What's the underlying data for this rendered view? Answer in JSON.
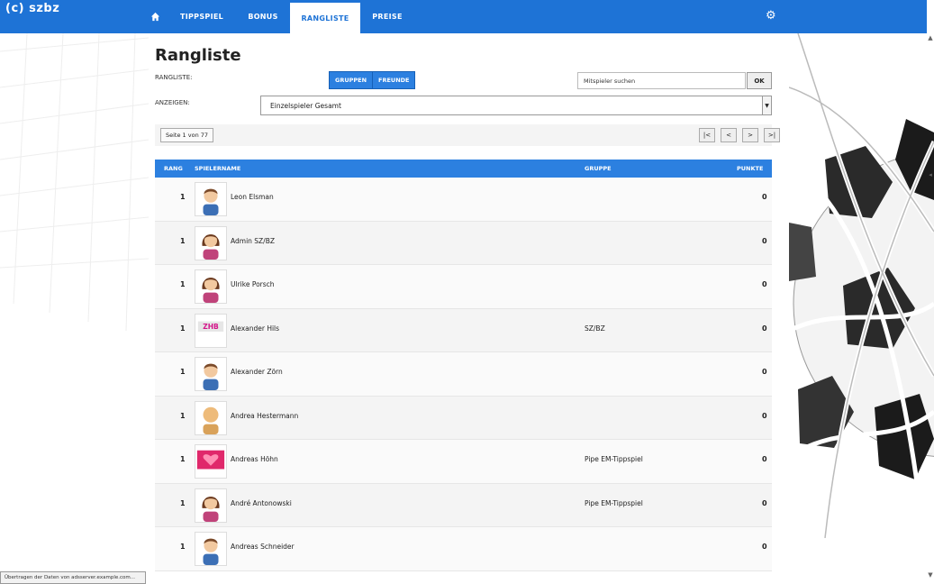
{
  "brand": "(c) szbz",
  "nav": {
    "home_icon": "home-icon",
    "items": [
      {
        "label": "TIPPSPIEL"
      },
      {
        "label": "BONUS"
      },
      {
        "label": "RANGLISTE"
      },
      {
        "label": "PREISE"
      }
    ],
    "active": "RANGLISTE",
    "settings_icon": "gear-icon"
  },
  "page": {
    "title": "Rangliste",
    "rangliste_label": "RANGLISTE:",
    "toggle": [
      "GRUPPEN",
      "FREUNDE"
    ],
    "search_value": "Mitspieler suchen",
    "ok_label": "OK",
    "anzeigen_label": "ANZEIGEN:",
    "select_value": "Einzelspieler Gesamt",
    "page_info": "Seite 1 von 77",
    "pager": [
      "|<",
      "<",
      ">",
      ">|"
    ]
  },
  "table": {
    "headers": {
      "rank": "RANG",
      "player": "SPIELERNAME",
      "group": "GRUPPE",
      "points": "PUNKTE"
    },
    "rows": [
      {
        "rank": "1",
        "avatar": "boy-avatar-icon",
        "player": "Leon Elsman",
        "group": "",
        "points": "0"
      },
      {
        "rank": "1",
        "avatar": "girl-avatar-icon",
        "player": "Admin SZ/BZ",
        "group": "",
        "points": "0"
      },
      {
        "rank": "1",
        "avatar": "girl-avatar-icon",
        "player": "Ulrike Porsch",
        "group": "",
        "points": "0"
      },
      {
        "rank": "1",
        "avatar": "logo-avatar-icon",
        "player": "Alexander Hils",
        "group": "SZ/BZ",
        "points": "0"
      },
      {
        "rank": "1",
        "avatar": "boy-avatar-icon",
        "player": "Alexander Zörn",
        "group": "",
        "points": "0"
      },
      {
        "rank": "1",
        "avatar": "bald-avatar-icon",
        "player": "Andrea Hestermann",
        "group": "",
        "points": "0"
      },
      {
        "rank": "1",
        "avatar": "heart-avatar-icon",
        "player": "Andreas Höhn",
        "group": "Pipe EM-Tippspiel",
        "points": "0"
      },
      {
        "rank": "1",
        "avatar": "girl-avatar-icon",
        "player": "André Antonowski",
        "group": "Pipe EM-Tippspiel",
        "points": "0"
      },
      {
        "rank": "1",
        "avatar": "boy-avatar-icon",
        "player": "Andreas Schneider",
        "group": "",
        "points": "0"
      }
    ]
  },
  "status_text": "Übertragen der Daten von adsserver.example.com..."
}
